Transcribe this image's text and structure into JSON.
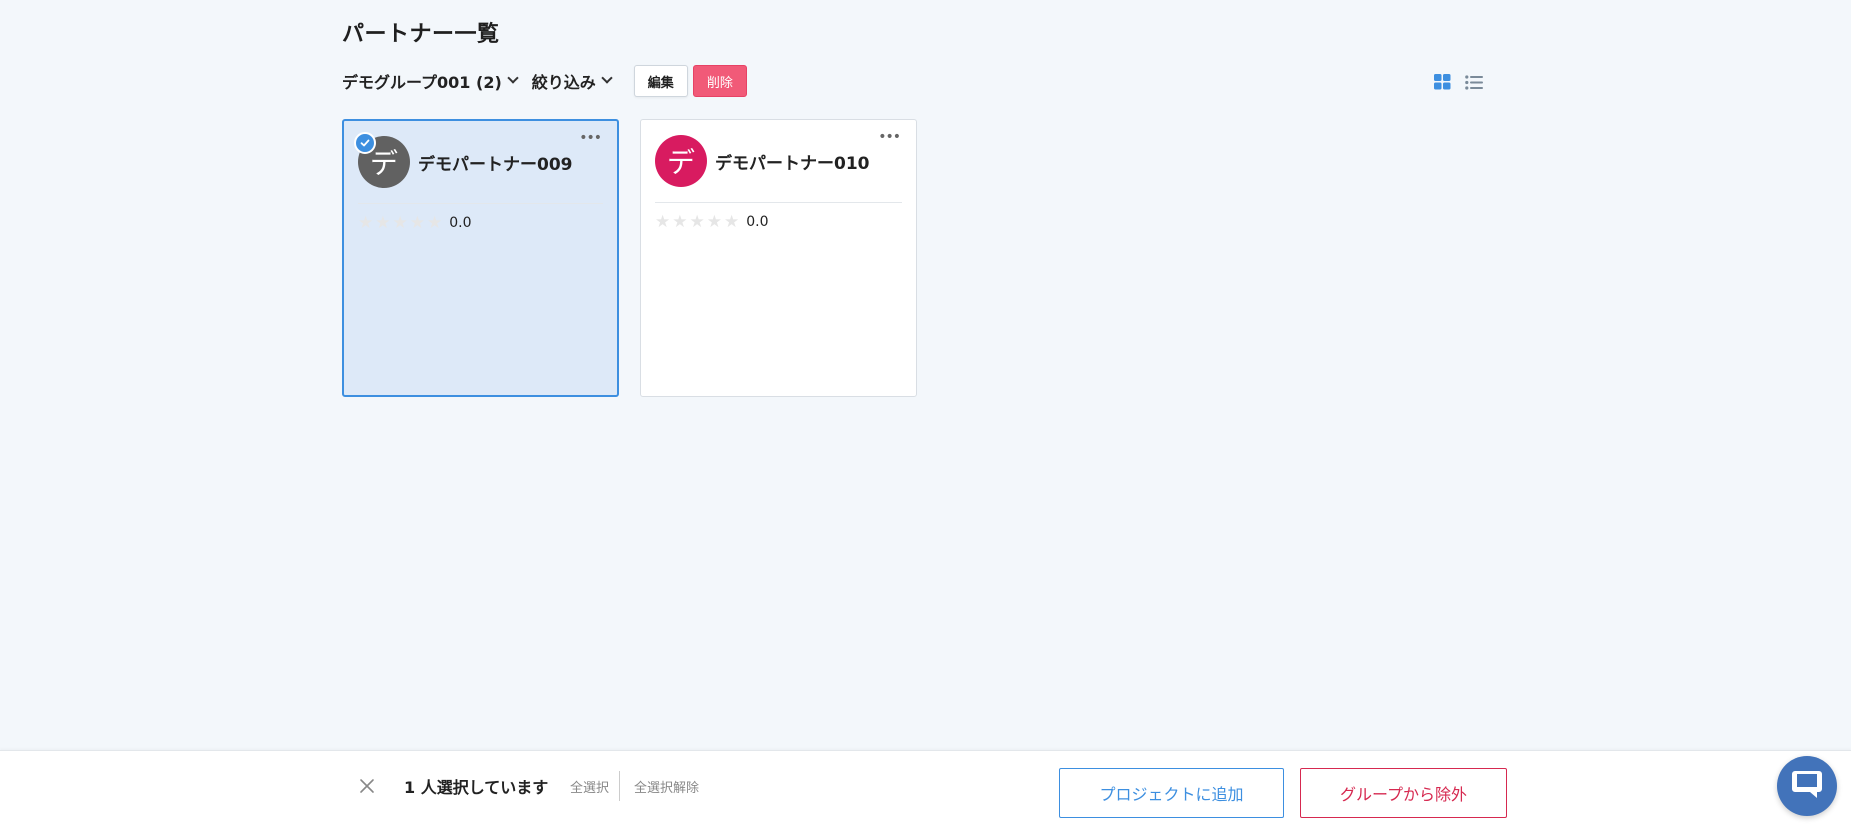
{
  "page": {
    "title": "パートナー一覧"
  },
  "toolbar": {
    "group_label": "デモグループ001 (2)",
    "filter_label": "絞り込み",
    "edit_label": "編集",
    "delete_label": "削除"
  },
  "view_toggles": {
    "grid_icon": "grid-view-icon",
    "list_icon": "list-view-icon",
    "active": "grid"
  },
  "partners": [
    {
      "name": "デモパートナー009",
      "avatar_char": "デ",
      "avatar_color": "#616161",
      "rating": "0.0",
      "selected": true
    },
    {
      "name": "デモパートナー010",
      "avatar_char": "デ",
      "avatar_color": "#d81b60",
      "rating": "0.0",
      "selected": false
    }
  ],
  "selection_bar": {
    "count_text": "1 人選択しています",
    "select_all": "全選択",
    "deselect_all": "全選択解除",
    "add_to_project": "プロジェクトに追加",
    "remove_from_group": "グループから除外"
  },
  "colors": {
    "accent": "#3d8fe0",
    "danger": "#d62950",
    "delete_button": "#f15a78",
    "chat_fab": "#4273ba"
  }
}
